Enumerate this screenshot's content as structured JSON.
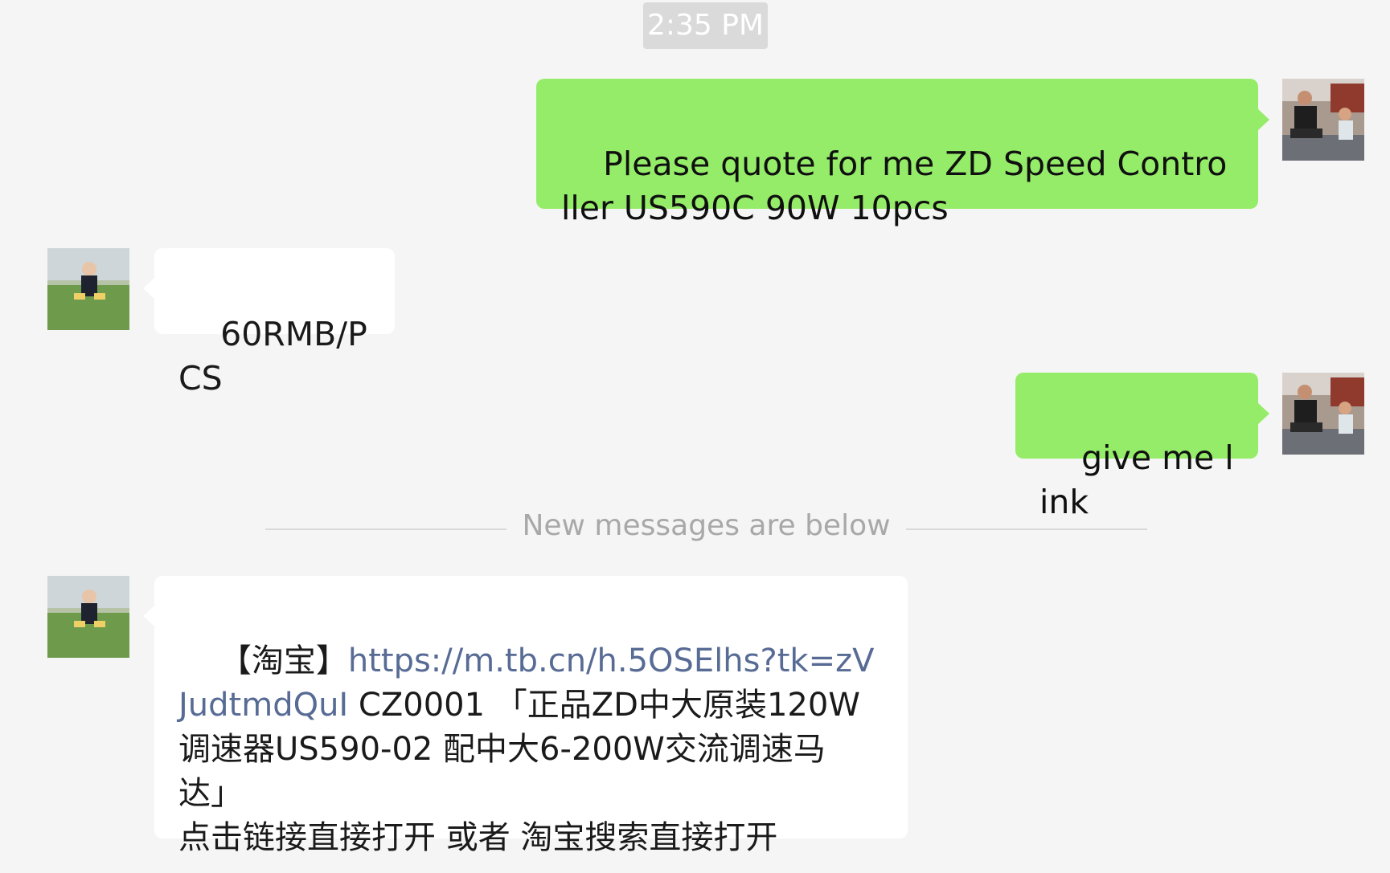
{
  "timestamp": "2:35 PM",
  "divider_text": "New messages are below",
  "colors": {
    "background": "#f5f5f5",
    "outgoing_bubble": "#95ec69",
    "incoming_bubble": "#ffffff",
    "link": "#576b95",
    "divider_text": "#a8a8a8"
  },
  "messages": [
    {
      "sender": "me",
      "avatar": "user-photo-avatar",
      "text": "Please quote for me ZD Speed Controller US590C 90W 10pcs"
    },
    {
      "sender": "contact",
      "avatar": "contact-baby-avatar",
      "text": "60RMB/PCS"
    },
    {
      "sender": "me",
      "avatar": "user-photo-avatar",
      "text": "give me link"
    },
    {
      "sender": "contact",
      "avatar": "contact-baby-avatar",
      "prefix": "【淘宝】",
      "link": "https://m.tb.cn/h.5OSElhs?tk=zVJudtmdQuI",
      "rest": " CZ0001 「正品ZD中大原装120W调速器US590-02 配中大6-200W交流调速马达」\n点击链接直接打开 或者 淘宝搜索直接打开"
    }
  ]
}
